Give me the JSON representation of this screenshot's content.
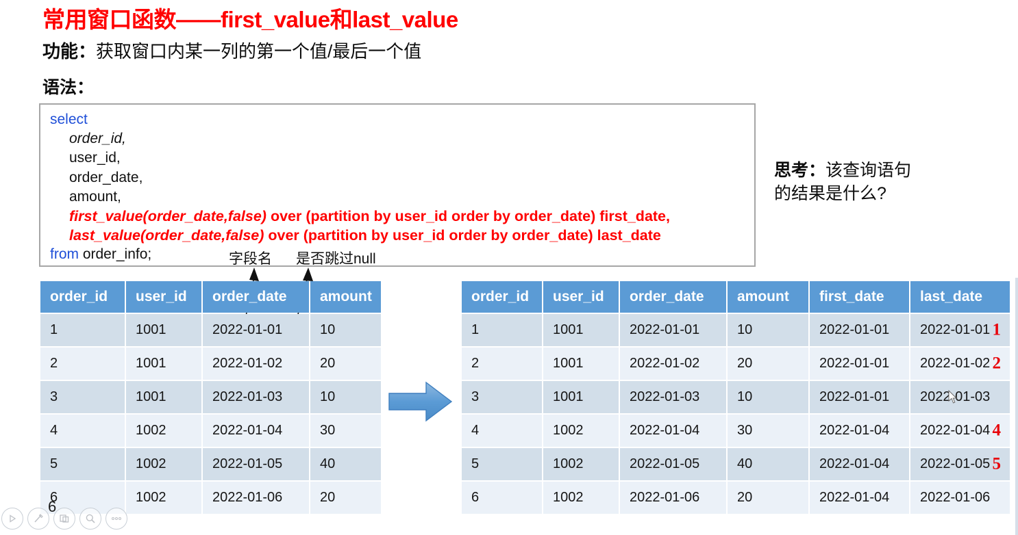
{
  "slide": {
    "title": "常用窗口函数——first_value和last_value",
    "function_label": "功能：",
    "function_text": "获取窗口内某一列的第一个值/最后一个值",
    "syntax_label": "语法：",
    "title_color": "#FF0000",
    "header_color": "#5B9BD5"
  },
  "code": {
    "line_select": "select",
    "line_order_id": "order_id,",
    "line_user_id": "user_id,",
    "line_order_date": "order_date,",
    "line_amount": "amount,",
    "line_first_value_fn": "first_value(order_date,false)",
    "line_first_value_rest": " over (partition by user_id order by order_date) first_date,",
    "line_last_value_fn": "last_value(order_date,false)",
    "line_last_value_rest": " over (partition by user_id order by order_date) last_date",
    "line_from_kw": "from",
    "line_from_rest": " order_info;"
  },
  "annotations": {
    "field_name": "字段名",
    "skip_null": "是否跳过null"
  },
  "think": {
    "label": "思考：",
    "line1": "该查询语句",
    "line2": "的结果是什么?"
  },
  "table_left": {
    "headers": [
      "order_id",
      "user_id",
      "order_date",
      "amount"
    ],
    "rows": [
      [
        "1",
        "1001",
        "2022-01-01",
        "10"
      ],
      [
        "2",
        "1001",
        "2022-01-02",
        "20"
      ],
      [
        "3",
        "1001",
        "2022-01-03",
        "10"
      ],
      [
        "4",
        "1002",
        "2022-01-04",
        "30"
      ],
      [
        "5",
        "1002",
        "2022-01-05",
        "40"
      ],
      [
        "6",
        "1002",
        "2022-01-06",
        "20"
      ]
    ]
  },
  "table_right": {
    "headers": [
      "order_id",
      "user_id",
      "order_date",
      "amount",
      "first_date",
      "last_date"
    ],
    "rows": [
      [
        "1",
        "1001",
        "2022-01-01",
        "10",
        "2022-01-01",
        "2022-01-01"
      ],
      [
        "2",
        "1001",
        "2022-01-02",
        "20",
        "2022-01-01",
        "2022-01-02"
      ],
      [
        "3",
        "1001",
        "2022-01-03",
        "10",
        "2022-01-01",
        "2022-01-03"
      ],
      [
        "4",
        "1002",
        "2022-01-04",
        "30",
        "2022-01-04",
        "2022-01-04"
      ],
      [
        "5",
        "1002",
        "2022-01-05",
        "40",
        "2022-01-04",
        "2022-01-05"
      ],
      [
        "6",
        "1002",
        "2022-01-06",
        "20",
        "2022-01-04",
        "2022-01-06"
      ]
    ],
    "red_marks": [
      "1",
      "2",
      "",
      "4",
      "5",
      ""
    ],
    "red_mark_color": "#E8040B"
  },
  "toolbar": {
    "items": [
      "play-icon",
      "pen-icon",
      "layout-icon",
      "search-icon",
      "more-icon"
    ],
    "page_marker": "6"
  }
}
